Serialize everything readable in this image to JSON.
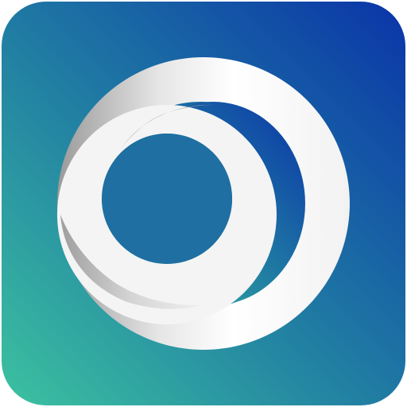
{
  "icon": {
    "name": "ring-logo-app-icon",
    "colors": {
      "gradient_start": "#3cc2a0",
      "gradient_mid": "#1f79a3",
      "gradient_end": "#0a34a8",
      "ring_light": "#ffffff",
      "ring_shadow": "#a9a9a9"
    }
  }
}
